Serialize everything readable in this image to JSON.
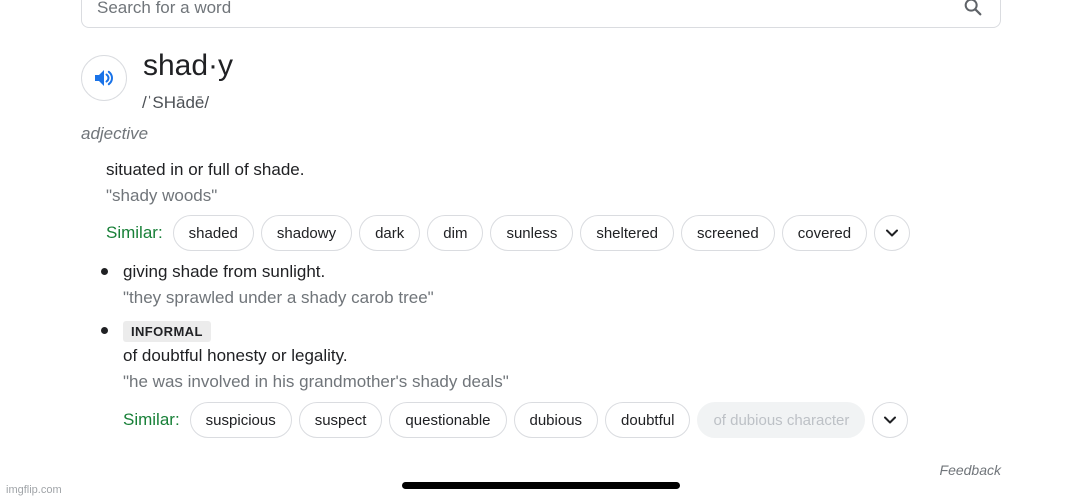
{
  "search": {
    "placeholder": "Search for a word"
  },
  "entry": {
    "headword": "shad·y",
    "phonetic": "/ˈSHādē/",
    "part_of_speech": "adjective"
  },
  "senses": [
    {
      "definition": "situated in or full of shade.",
      "example": "\"shady woods\"",
      "similar_label": "Similar:",
      "similar": [
        "shaded",
        "shadowy",
        "dark",
        "dim",
        "sunless",
        "sheltered",
        "screened",
        "covered"
      ]
    },
    {
      "definition": "giving shade from sunlight.",
      "example": "\"they sprawled under a shady carob tree\""
    },
    {
      "label": "INFORMAL",
      "definition": "of doubtful honesty or legality.",
      "example": "\"he was involved in his grandmother's shady deals\"",
      "similar_label": "Similar:",
      "similar": [
        "suspicious",
        "suspect",
        "questionable",
        "dubious",
        "doubtful"
      ],
      "similar_disabled": "of dubious character"
    }
  ],
  "footer": {
    "feedback": "Feedback"
  },
  "watermark": "imgflip.com",
  "icons": {
    "search": "search-icon",
    "audio": "speaker-icon",
    "more": "chevron-down-icon"
  },
  "colors": {
    "accent_blue": "#1a73e8",
    "similar_green": "#188038"
  }
}
